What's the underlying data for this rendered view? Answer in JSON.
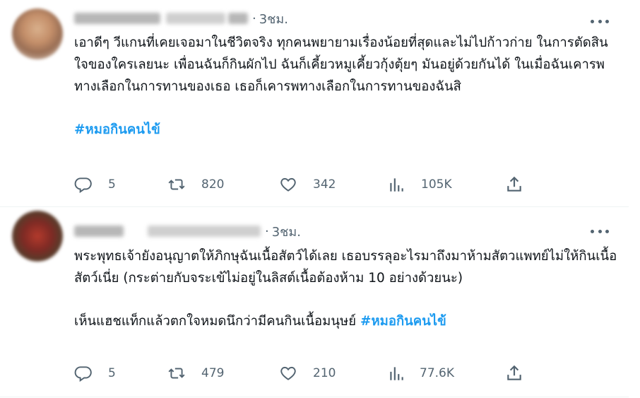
{
  "tweets": [
    {
      "time": "3ชม.",
      "separator": "·",
      "paragraphs": [
        "เอาดีๆ วีแกนที่เคยเจอมาในชีวิตจริง ทุกคนพยายามเรื่องน้อยที่สุดและไม่ไปก้าวก่าย ในการตัดสินใจของใครเลยนะ เพื่อนฉันก็กินผักไป ฉันก็เคี้ยวหมูเคี้ยวกุ้งตุ้ยๆ มันอยู่ด้วยกันได้ ในเมื่อฉันเคารพทางเลือกในการทานของเธอ เธอก็เคารพทางเลือกในการทานของฉันสิ"
      ],
      "hashtag_line_text": "",
      "hashtag": "#หมอกินคนไข้",
      "stats": {
        "replies": "5",
        "reposts": "820",
        "likes": "342",
        "views": "105K"
      }
    },
    {
      "time": "3ชม.",
      "separator": "·",
      "paragraphs": [
        "พระพุทธเจ้ายังอนุญาตให้ภิกษุฉันเนื้อสัตว์ได้เลย เธอบรรลุอะไรมาถึงมาห้ามสัตวแพทย์ไม่ให้กินเนื้อสัตว์เนี่ย (กระต่ายกับจระเข้ไม่อยู่ในลิสต์เนื้อต้องห้าม 10 อย่างด้วยนะ)"
      ],
      "hashtag_line_text": "เห็นแฮชแท็กแล้วตกใจหมดนึกว่ามีคนกินเนื้อมนุษย์ ",
      "hashtag": "#หมอกินคนไข้",
      "stats": {
        "replies": "5",
        "reposts": "479",
        "likes": "210",
        "views": "77.6K"
      }
    }
  ],
  "icons": {
    "reply": "reply-icon",
    "repost": "repost-icon",
    "like": "heart-icon",
    "views": "views-chart-icon",
    "share": "share-icon",
    "more": "more-dots-icon"
  },
  "colors": {
    "text": "#0f1419",
    "muted": "#536471",
    "accent": "#1d9bf0",
    "divider": "#eff3f4"
  }
}
